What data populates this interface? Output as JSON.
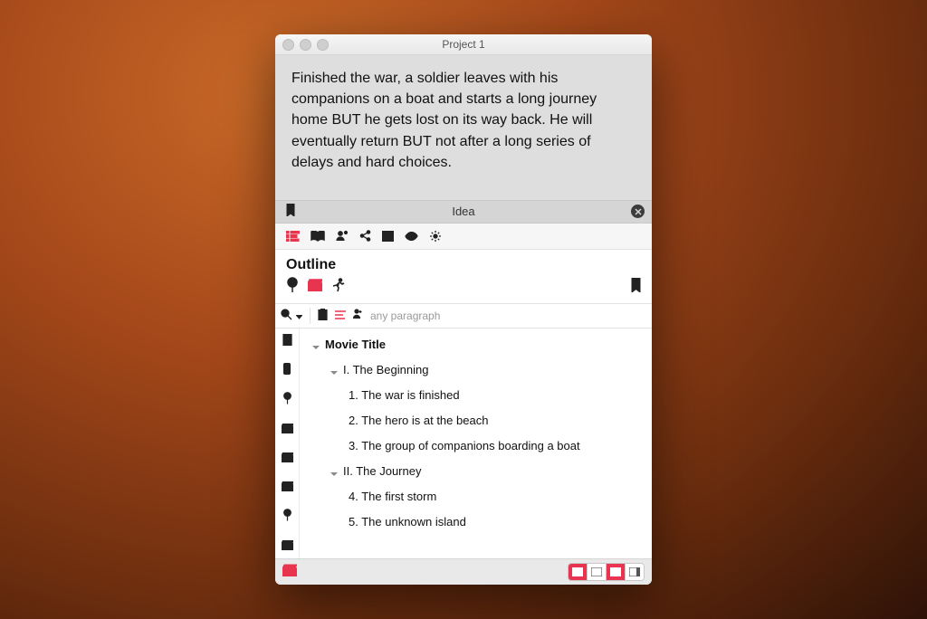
{
  "window": {
    "title": "Project 1"
  },
  "summary": {
    "text": "Finished the war, a soldier leaves with his companions on a boat and starts a long journey home BUT he gets lost on its way back. He will eventually return BUT not after a long series of delays and hard choices."
  },
  "idea_bar": {
    "label": "Idea"
  },
  "section": {
    "title": "Outline"
  },
  "filter": {
    "placeholder": "any paragraph"
  },
  "tree": {
    "truncated": "…",
    "root": "Movie Title",
    "acts": [
      {
        "label": "I. The Beginning",
        "scenes": [
          "1. The war is finished",
          "2. The hero is at the beach",
          "3. The group of companions boarding a boat"
        ]
      },
      {
        "label": "II. The Journey",
        "scenes": [
          "4. The first storm",
          "5. The unknown island"
        ]
      }
    ]
  }
}
